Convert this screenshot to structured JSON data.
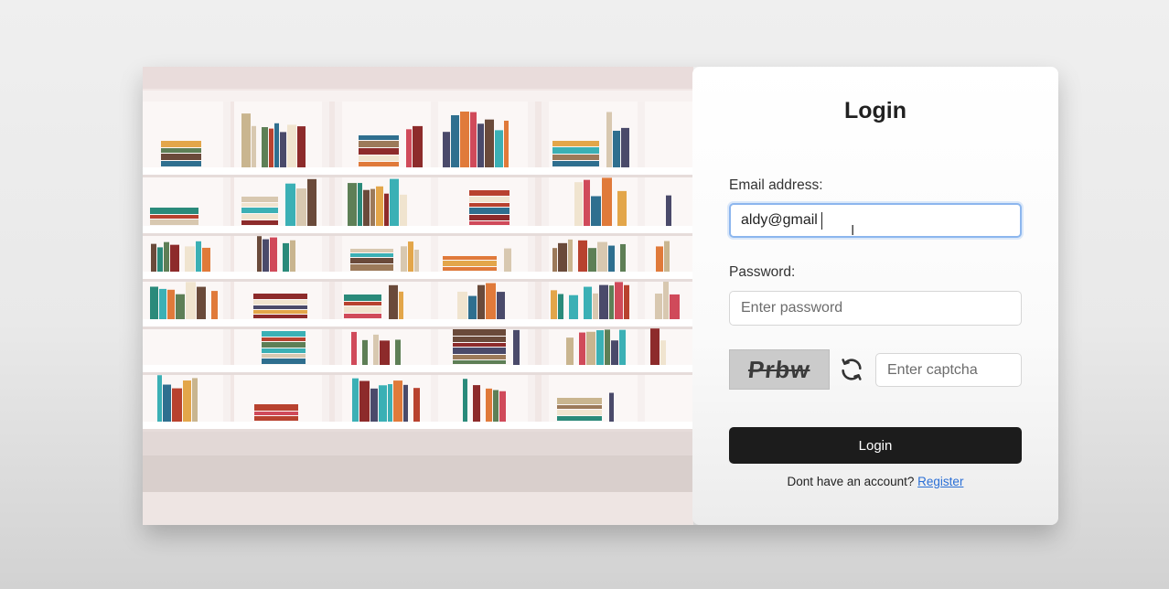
{
  "login": {
    "title": "Login",
    "email_label": "Email address:",
    "email_value": "aldy@gmail",
    "password_label": "Password:",
    "password_placeholder": "Enter password",
    "captcha_code": "Prbw",
    "captcha_placeholder": "Enter captcha",
    "submit_label": "Login",
    "register_prompt": "Dont have an account?",
    "register_link": "Register"
  },
  "icons": {
    "refresh": "refresh-icon",
    "cursor": "text-cursor-icon"
  },
  "colors": {
    "button_bg": "#1c1c1c",
    "link": "#2a6fd6",
    "focus_border": "#8cb6ee"
  }
}
